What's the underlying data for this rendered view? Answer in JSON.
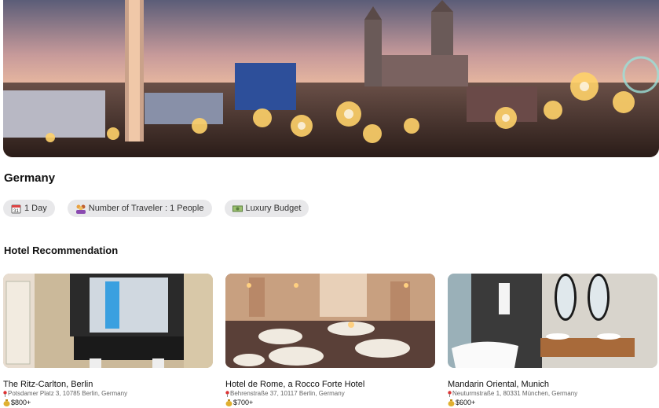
{
  "destination": {
    "title": "Germany"
  },
  "chips": [
    {
      "label": "1 Day",
      "icon": "calendar-icon"
    },
    {
      "label": "Number of Traveler : 1 People",
      "icon": "people-icon"
    },
    {
      "label": "Luxury Budget",
      "icon": "money-icon"
    }
  ],
  "hotels": {
    "section_title": "Hotel Recommendation",
    "items": [
      {
        "name": "The Ritz-Carlton, Berlin",
        "address": "Potsdamer Platz 3, 10785 Berlin, Germany",
        "price": "$800+"
      },
      {
        "name": "Hotel de Rome, a Rocco Forte Hotel",
        "address": "Behrenstraße 37, 10117 Berlin, Germany",
        "price": "$700+"
      },
      {
        "name": "Mandarin Oriental, Munich",
        "address": "Neuturmstraße 1, 80331 München, Germany",
        "price": "$600+"
      }
    ]
  },
  "icons": {
    "address": "pin-icon",
    "price": "money-bag-icon"
  }
}
